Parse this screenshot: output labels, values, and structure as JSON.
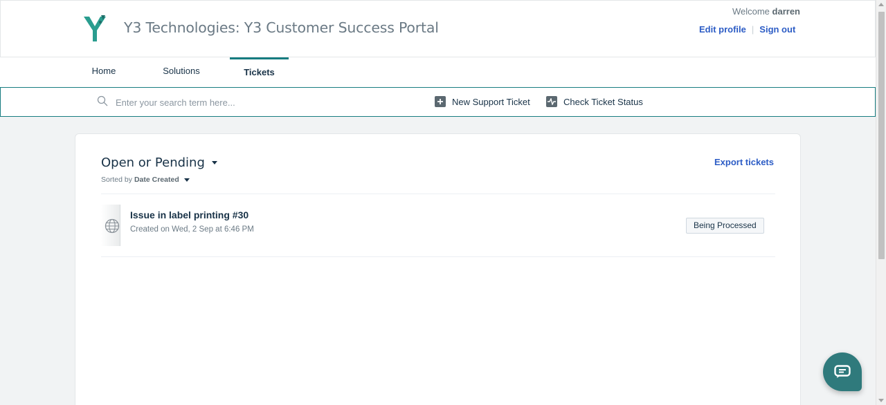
{
  "header": {
    "portal_title": "Y3 Technologies: Y3 Customer Success Portal",
    "welcome_label": "Welcome",
    "username": "darren",
    "edit_profile": "Edit profile",
    "sign_out": "Sign out",
    "separator": "|",
    "logo_icon": "y3-logo"
  },
  "nav": {
    "tabs": [
      {
        "label": "Home",
        "active": false
      },
      {
        "label": "Solutions",
        "active": false
      },
      {
        "label": "Tickets",
        "active": true
      }
    ]
  },
  "search": {
    "placeholder": "Enter your search term here...",
    "value": "",
    "icon": "search-icon",
    "actions": [
      {
        "label": "New Support Ticket",
        "icon": "plus-square-icon"
      },
      {
        "label": "Check Ticket Status",
        "icon": "pulse-icon"
      }
    ]
  },
  "tickets": {
    "filter_label": "Open or Pending",
    "sorted_by_label": "Sorted by",
    "sort_field": "Date Created",
    "export_label": "Export tickets",
    "items": [
      {
        "subject": "Issue in label printing #30",
        "created": "Created on Wed, 2 Sep at 6:46 PM",
        "status": "Being Processed",
        "icon": "globe-icon"
      }
    ]
  },
  "colors": {
    "accent": "#167c80",
    "link": "#2c5cc5",
    "chat_button": "#2f7a7c"
  }
}
